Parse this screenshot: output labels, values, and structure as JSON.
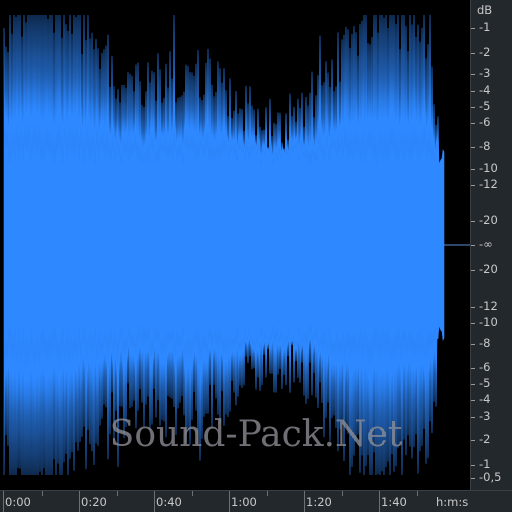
{
  "waveform": {
    "fill_color": "#2e88ff",
    "background": "#000000",
    "silence_line_color": "#5a8fd6"
  },
  "db_scale": {
    "unit_label": "dB",
    "upper_labels": [
      "-1",
      "-2",
      "-3",
      "-4",
      "-5",
      "-6",
      "-8",
      "-10",
      "-12",
      "-20"
    ],
    "center_label": "-∞",
    "lower_labels": [
      "-20",
      "-12",
      "-10",
      "-8",
      "-6",
      "-5",
      "-4",
      "-3",
      "-2",
      "-1",
      "-0,5"
    ]
  },
  "time_ruler": {
    "labels": [
      "0:00",
      "0:20",
      "0:40",
      "1:00",
      "1:20",
      "1:40"
    ],
    "unit_label": "h:m:s"
  },
  "watermark": "Sound-Pack.Net"
}
